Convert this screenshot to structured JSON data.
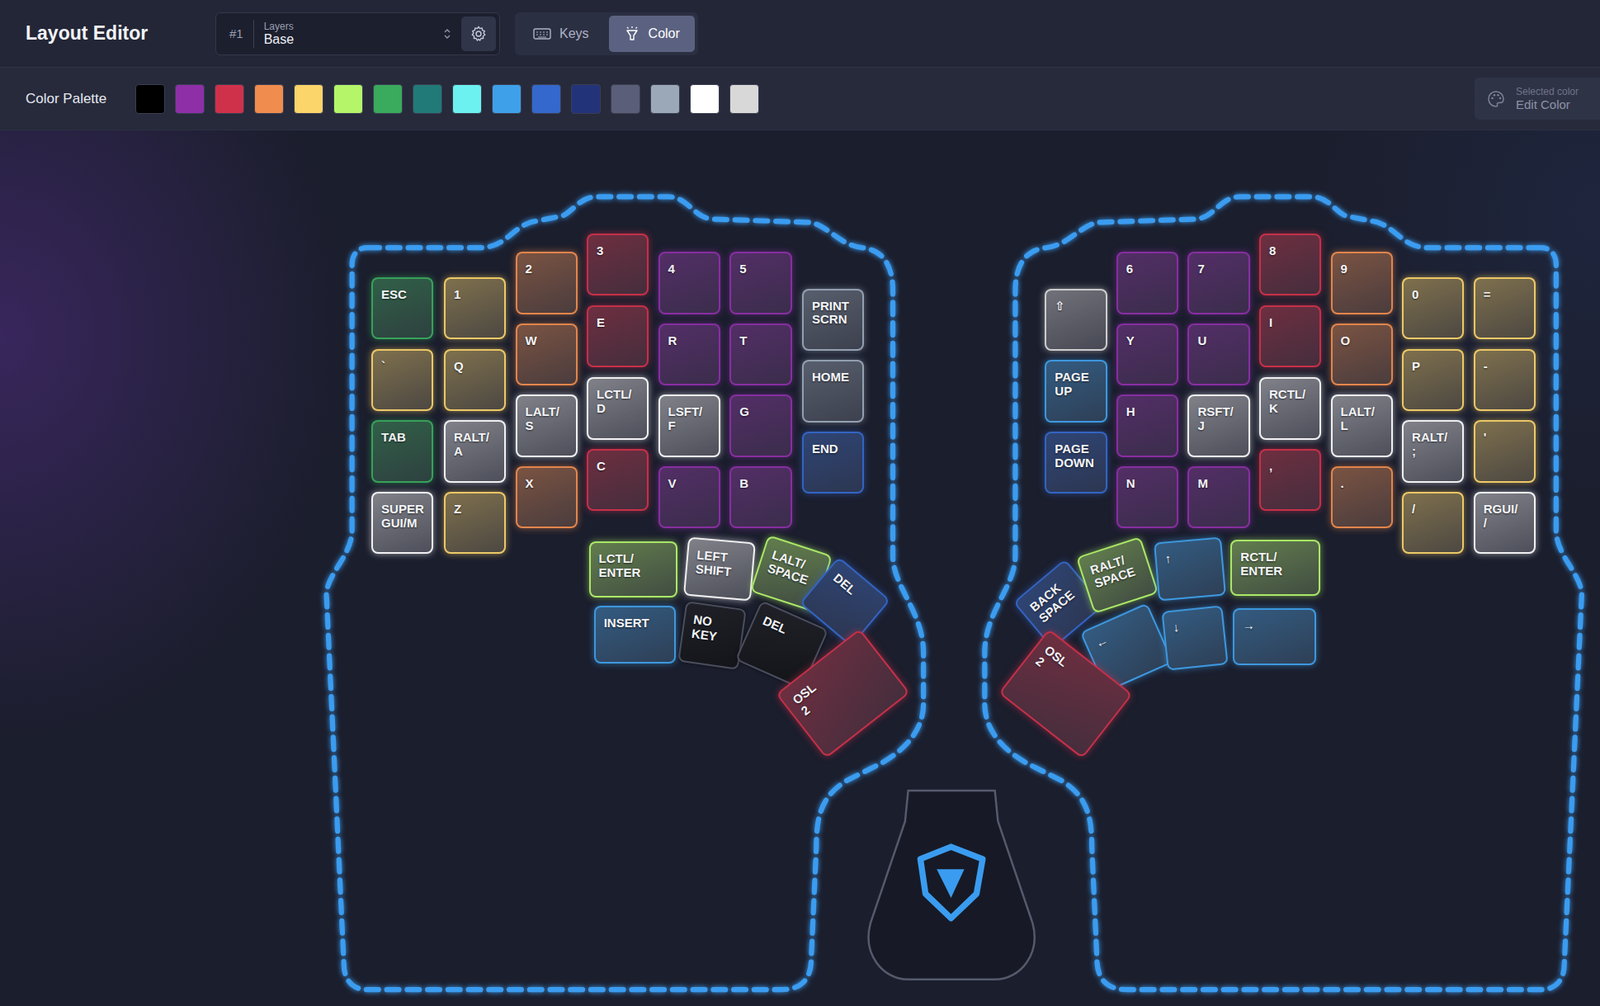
{
  "header": {
    "title": "Layout Editor",
    "layer": {
      "number": "#1",
      "label": "Layers",
      "value": "Base"
    },
    "modes": [
      {
        "label": "Keys",
        "selected": false
      },
      {
        "label": "Color",
        "selected": true
      }
    ]
  },
  "palette": {
    "label": "Color Palette",
    "swatches": [
      {
        "color": "#000000"
      },
      {
        "color": "#8e2fa8"
      },
      {
        "color": "#d0314a"
      },
      {
        "color": "#f08c4e"
      },
      {
        "color": "#fbd46a"
      },
      {
        "color": "#b4f56a"
      },
      {
        "color": "#3aaa5c"
      },
      {
        "color": "#227a78"
      },
      {
        "color": "#6df0f0"
      },
      {
        "color": "#3fa0ea"
      },
      {
        "color": "#3468cc"
      },
      {
        "color": "#23337a"
      },
      {
        "color": "#5a5e78"
      },
      {
        "color": "#9aa8b8"
      },
      {
        "color": "#ffffff"
      },
      {
        "color": "#d8d8d8"
      }
    ],
    "selected_color": {
      "label": "Selected color",
      "action": "Edit Color"
    }
  },
  "keyboard": {
    "left": {
      "keys": [
        {
          "lines": [
            "ESC"
          ],
          "color": "#3aaa5c"
        },
        {
          "lines": [
            "`"
          ],
          "color": "#fbd46a"
        },
        {
          "lines": [
            "TAB"
          ],
          "color": "#3aaa5c"
        },
        {
          "lines": [
            "SUPER",
            "GUI/M"
          ],
          "color": "#ffffff"
        },
        {
          "lines": [
            "1"
          ],
          "color": "#fbd46a"
        },
        {
          "lines": [
            "Q"
          ],
          "color": "#fbd46a"
        },
        {
          "lines": [
            "RALT/",
            "A"
          ],
          "color": "#ffffff"
        },
        {
          "lines": [
            "Z"
          ],
          "color": "#fbd46a"
        },
        {
          "lines": [
            "2"
          ],
          "color": "#f08c4e"
        },
        {
          "lines": [
            "W"
          ],
          "color": "#f08c4e"
        },
        {
          "lines": [
            "LALT/",
            "S"
          ],
          "color": "#ffffff"
        },
        {
          "lines": [
            "X"
          ],
          "color": "#f08c4e"
        },
        {
          "lines": [
            "3"
          ],
          "color": "#d0314a"
        },
        {
          "lines": [
            "E"
          ],
          "color": "#d0314a"
        },
        {
          "lines": [
            "LCTL/",
            "D"
          ],
          "color": "#ffffff"
        },
        {
          "lines": [
            "C"
          ],
          "color": "#d0314a"
        },
        {
          "lines": [
            "4"
          ],
          "color": "#8e2fa8"
        },
        {
          "lines": [
            "R"
          ],
          "color": "#8e2fa8"
        },
        {
          "lines": [
            "LSFT/",
            "F"
          ],
          "color": "#ffffff"
        },
        {
          "lines": [
            "V"
          ],
          "color": "#8e2fa8"
        },
        {
          "lines": [
            "5"
          ],
          "color": "#8e2fa8"
        },
        {
          "lines": [
            "T"
          ],
          "color": "#8e2fa8"
        },
        {
          "lines": [
            "G"
          ],
          "color": "#8e2fa8"
        },
        {
          "lines": [
            "B"
          ],
          "color": "#8e2fa8"
        },
        {
          "lines": [
            "PRINT",
            "SCRN"
          ],
          "color": "#9aa8b8"
        },
        {
          "lines": [
            "HOME"
          ],
          "color": "#9aa8b8"
        },
        {
          "lines": [
            "END"
          ],
          "color": "#3468cc"
        },
        {
          "lines": [
            "LCTL/",
            "ENTER"
          ],
          "color": "#b4f56a"
        },
        {
          "lines": [
            "LEFT",
            "SHIFT"
          ],
          "color": "#ffffff"
        },
        {
          "lines": [
            "LALT/",
            "SPACE"
          ],
          "color": "#b4f56a"
        },
        {
          "lines": [
            "DEL"
          ],
          "color": "#3468cc"
        },
        {
          "lines": [
            "INSERT"
          ],
          "color": "#3fa0ea"
        },
        {
          "lines": [
            "NO",
            "KEY"
          ],
          "color": "#000000"
        },
        {
          "lines": [
            "DEL"
          ],
          "color": "#000000"
        },
        {
          "lines": [
            "OSL",
            "2"
          ],
          "color": "#d0314a"
        }
      ]
    },
    "right": {
      "keys": [
        {
          "lines": [
            "⇧"
          ],
          "color": "#d8d8d8"
        },
        {
          "lines": [
            "PAGE",
            "UP"
          ],
          "color": "#3fa0ea"
        },
        {
          "lines": [
            "PAGE",
            "DOWN"
          ],
          "color": "#3468cc"
        },
        {
          "lines": [
            "6"
          ],
          "color": "#8e2fa8"
        },
        {
          "lines": [
            "Y"
          ],
          "color": "#8e2fa8"
        },
        {
          "lines": [
            "H"
          ],
          "color": "#8e2fa8"
        },
        {
          "lines": [
            "N"
          ],
          "color": "#8e2fa8"
        },
        {
          "lines": [
            "7"
          ],
          "color": "#8e2fa8"
        },
        {
          "lines": [
            "U"
          ],
          "color": "#8e2fa8"
        },
        {
          "lines": [
            "RSFT/",
            "J"
          ],
          "color": "#ffffff"
        },
        {
          "lines": [
            "M"
          ],
          "color": "#8e2fa8"
        },
        {
          "lines": [
            "8"
          ],
          "color": "#d0314a"
        },
        {
          "lines": [
            "I"
          ],
          "color": "#d0314a"
        },
        {
          "lines": [
            "RCTL/",
            "K"
          ],
          "color": "#ffffff"
        },
        {
          "lines": [
            ","
          ],
          "color": "#d0314a"
        },
        {
          "lines": [
            "9"
          ],
          "color": "#f08c4e"
        },
        {
          "lines": [
            "O"
          ],
          "color": "#f08c4e"
        },
        {
          "lines": [
            "LALT/",
            "L"
          ],
          "color": "#ffffff"
        },
        {
          "lines": [
            "."
          ],
          "color": "#f08c4e"
        },
        {
          "lines": [
            "0"
          ],
          "color": "#fbd46a"
        },
        {
          "lines": [
            "P"
          ],
          "color": "#fbd46a"
        },
        {
          "lines": [
            "RALT/",
            ";"
          ],
          "color": "#ffffff"
        },
        {
          "lines": [
            "/"
          ],
          "color": "#fbd46a"
        },
        {
          "lines": [
            "="
          ],
          "color": "#fbd46a"
        },
        {
          "lines": [
            "-"
          ],
          "color": "#fbd46a"
        },
        {
          "lines": [
            "'"
          ],
          "color": "#fbd46a"
        },
        {
          "lines": [
            "RGUI/",
            "/"
          ],
          "color": "#ffffff"
        },
        {
          "lines": [
            "BACK",
            "SPACE"
          ],
          "color": "#3468cc"
        },
        {
          "lines": [
            "RALT/",
            "SPACE"
          ],
          "color": "#b4f56a"
        },
        {
          "lines": [
            "↑"
          ],
          "color": "#3fa0ea"
        },
        {
          "lines": [
            "RCTL/",
            "ENTER"
          ],
          "color": "#b4f56a"
        },
        {
          "lines": [
            "←"
          ],
          "color": "#3fa0ea"
        },
        {
          "lines": [
            "↓"
          ],
          "color": "#3fa0ea"
        },
        {
          "lines": [
            "→"
          ],
          "color": "#3fa0ea"
        },
        {
          "lines": [
            "OSL",
            "2"
          ],
          "color": "#d0314a"
        }
      ]
    }
  }
}
